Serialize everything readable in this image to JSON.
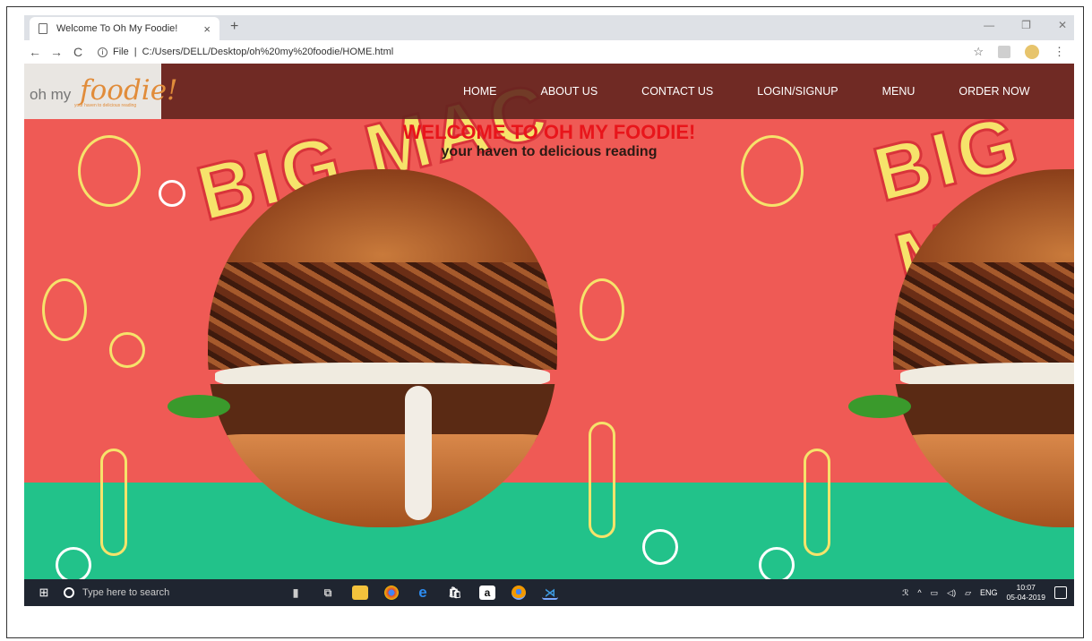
{
  "browser": {
    "tab_title": "Welcome To Oh My Foodie!",
    "tab_close": "×",
    "new_tab": "+",
    "window_controls": [
      "—",
      "❐",
      "✕"
    ],
    "nav": {
      "back": "←",
      "forward": "→",
      "reload": "C"
    },
    "url_prefix": "File",
    "url": "C:/Users/DELL/Desktop/oh%20my%20foodie/HOME.html",
    "star": "☆",
    "kebab": "⋮"
  },
  "site": {
    "logo": {
      "prefix": "oh my",
      "brand": "foodie!",
      "tagline": "your haven to delicious reading"
    },
    "menu": [
      "HOME",
      "ABOUT US",
      "CONTACT US",
      "LOGIN/SIGNUP",
      "MENU",
      "ORDER NOW"
    ],
    "heading": "WELCOME TO OH MY FOODIE!",
    "subheading": "your haven to delicious reading",
    "banner_text": "BIG MAC",
    "colors": {
      "coral": "#ef5a55",
      "green": "#22c28a",
      "yellow": "#f6e36b",
      "header": "#5f231e",
      "heading_red": "#e8151b"
    }
  },
  "taskbar": {
    "search_placeholder": "Type here to search",
    "apps": [
      "mic-icon",
      "task-view-icon",
      "file-explorer-icon",
      "chrome-icon",
      "edge-icon",
      "store-icon",
      "amazon-icon",
      "chrome-canary-icon",
      "vscode-icon"
    ],
    "amazon_glyph": "a",
    "edge_glyph": "e",
    "language": "ENG",
    "time": "10:07",
    "date": "05-04-2019"
  }
}
